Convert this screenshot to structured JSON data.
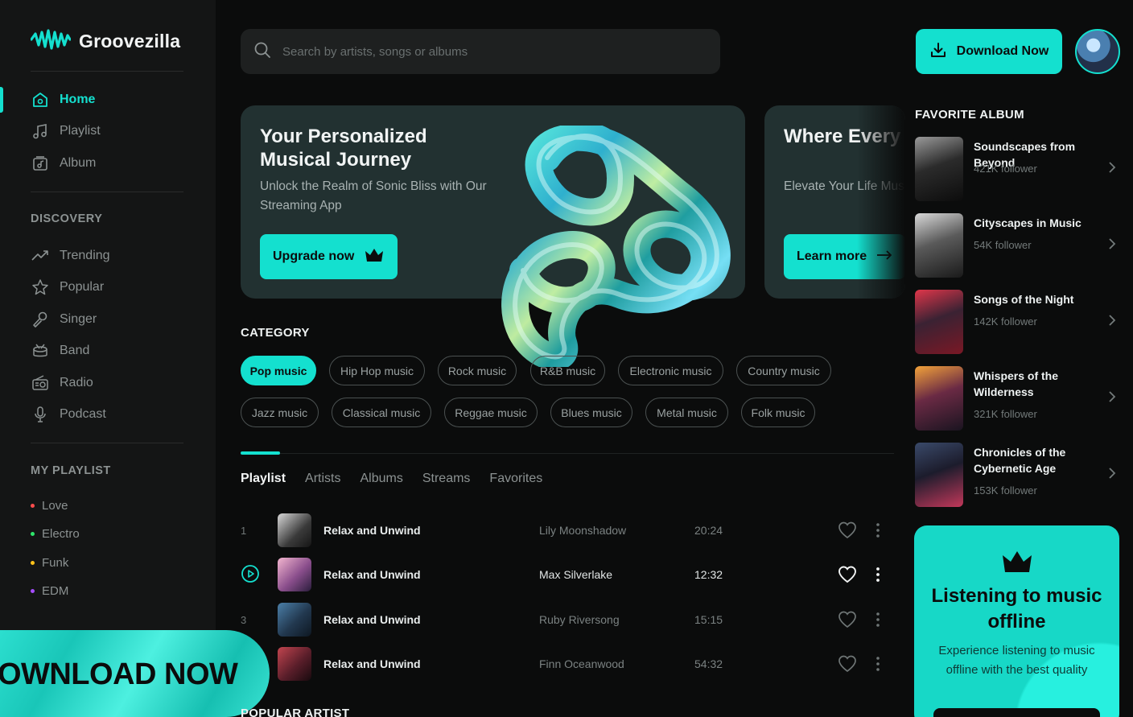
{
  "app": {
    "name": "Groovezilla",
    "accent": "#14e0cf"
  },
  "search": {
    "placeholder": "Search by artists, songs or albums"
  },
  "header": {
    "download_label": "Download Now"
  },
  "sidebar": {
    "nav": [
      {
        "label": "Home",
        "icon": "home-icon"
      },
      {
        "label": "Playlist",
        "icon": "music-note-icon"
      },
      {
        "label": "Album",
        "icon": "album-icon"
      }
    ],
    "discovery_label": "DISCOVERY",
    "discovery": [
      {
        "label": "Trending",
        "icon": "trending-icon"
      },
      {
        "label": "Popular",
        "icon": "star-icon"
      },
      {
        "label": "Singer",
        "icon": "singer-icon"
      },
      {
        "label": "Band",
        "icon": "band-icon"
      },
      {
        "label": "Radio",
        "icon": "radio-icon"
      },
      {
        "label": "Podcast",
        "icon": "microphone-icon"
      }
    ],
    "my_playlist_label": "MY PLAYLIST",
    "playlists": [
      {
        "label": "Love",
        "color": "#ff4d4d"
      },
      {
        "label": "Electro",
        "color": "#2ee66b"
      },
      {
        "label": "Funk",
        "color": "#ffc21a"
      },
      {
        "label": "EDM",
        "color": "#a64dff"
      }
    ],
    "promo_text": "DOWNLOAD NOW"
  },
  "hero": [
    {
      "title": "Your Personalized Musical Journey",
      "subtitle": "Unlock the Realm of Sonic Bliss with Our Streaming App",
      "button": "Upgrade now"
    },
    {
      "title": "Where Every Finds a Home",
      "subtitle": "Elevate Your Life Music Streaming",
      "button": "Learn more"
    }
  ],
  "category": {
    "title": "CATEGORY",
    "chips": [
      "Pop music",
      "Hip Hop music",
      "Rock music",
      "R&B music",
      "Electronic music",
      "Country music",
      "Jazz music",
      "Classical music",
      "Reggae music",
      "Blues music",
      "Metal music",
      "Folk music"
    ]
  },
  "tabs": [
    "Playlist",
    "Artists",
    "Albums",
    "Streams",
    "Favorites"
  ],
  "tracks": [
    {
      "num": "1",
      "title": "Relax and Unwind",
      "artist": "Lily Moonshadow",
      "duration": "20:24"
    },
    {
      "num": "",
      "title": "Relax and Unwind",
      "artist": "Max Silverlake",
      "duration": "12:32"
    },
    {
      "num": "3",
      "title": "Relax and Unwind",
      "artist": "Ruby Riversong",
      "duration": "15:15"
    },
    {
      "num": "",
      "title": "Relax and Unwind",
      "artist": "Finn Oceanwood",
      "duration": "54:32"
    }
  ],
  "popular_artist_title": "POPULAR ARTIST",
  "favorite_album": {
    "title": "FAVORITE ALBUM",
    "albums": [
      {
        "name": "Soundscapes from Beyond",
        "followers": "421K follower"
      },
      {
        "name": "Cityscapes in Music",
        "followers": "54K follower"
      },
      {
        "name": "Songs of the Night",
        "followers": "142K follower"
      },
      {
        "name": "Whispers of the Wilderness",
        "followers": "321K follower"
      },
      {
        "name": "Chronicles of the Cybernetic Age",
        "followers": "153K follower"
      }
    ]
  },
  "offline_card": {
    "title": "Listening to music offline",
    "subtitle": "Experience listening to music offline with the best quality"
  }
}
